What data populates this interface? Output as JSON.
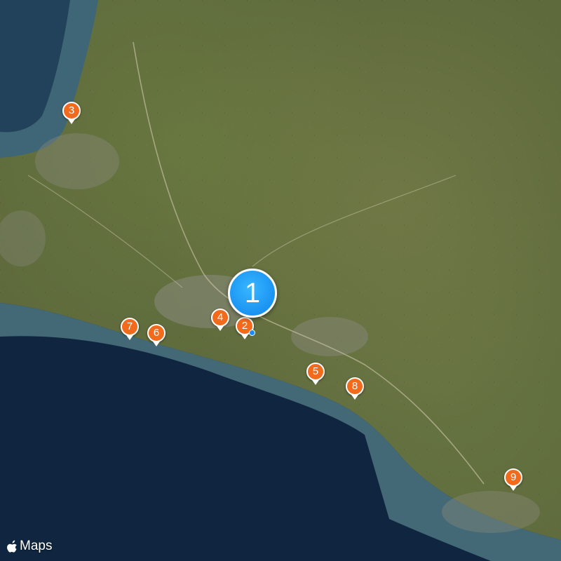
{
  "map": {
    "type": "satellite",
    "colors": {
      "sea": "#1b3550",
      "land": "#5e6a3c",
      "pin": "#f26a1b",
      "cluster": "#1a93f2"
    },
    "cluster": {
      "label": "1"
    },
    "markers": [
      {
        "label": "2",
        "icon": "map-pin"
      },
      {
        "label": "3",
        "icon": "map-pin"
      },
      {
        "label": "4",
        "icon": "map-pin"
      },
      {
        "label": "5",
        "icon": "map-pin"
      },
      {
        "label": "6",
        "icon": "map-pin"
      },
      {
        "label": "7",
        "icon": "map-pin"
      },
      {
        "label": "8",
        "icon": "map-pin"
      },
      {
        "label": "9",
        "icon": "map-pin"
      }
    ]
  },
  "brand": {
    "logo_icon": "apple-logo-icon",
    "label": "Maps"
  }
}
